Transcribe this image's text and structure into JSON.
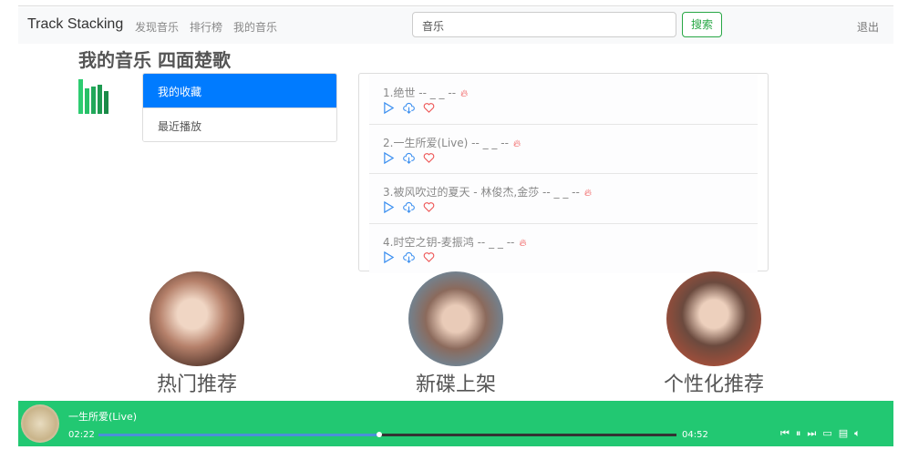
{
  "nav": {
    "brand": "Track Stacking",
    "links": [
      "发现音乐",
      "排行榜",
      "我的音乐"
    ],
    "search_value": "音乐",
    "search_button": "搜索",
    "logout": "退出"
  },
  "page_title": "我的音乐 四面楚歌",
  "menu": [
    {
      "label": "我的收藏",
      "active": true
    },
    {
      "label": "最近播放",
      "active": false
    }
  ],
  "songs": [
    {
      "title": "1.绝世 -- _ _ --"
    },
    {
      "title": "2.一生所爱(Live) -- _ _ --"
    },
    {
      "title": "3.被风吹过的夏天 - 林俊杰,金莎 -- _ _ --"
    },
    {
      "title": "4.时空之钥-麦振鸿 -- _ _ --"
    }
  ],
  "recommend": [
    {
      "label": "热门推荐"
    },
    {
      "label": "新碟上架"
    },
    {
      "label": "个性化推荐"
    }
  ],
  "player": {
    "song": "一生所爱(Live)",
    "current": "02:22",
    "total": "04:52",
    "progress": 0.486
  },
  "colors": {
    "accent": "#007bff",
    "player": "#22c872",
    "search": "#28a745"
  }
}
